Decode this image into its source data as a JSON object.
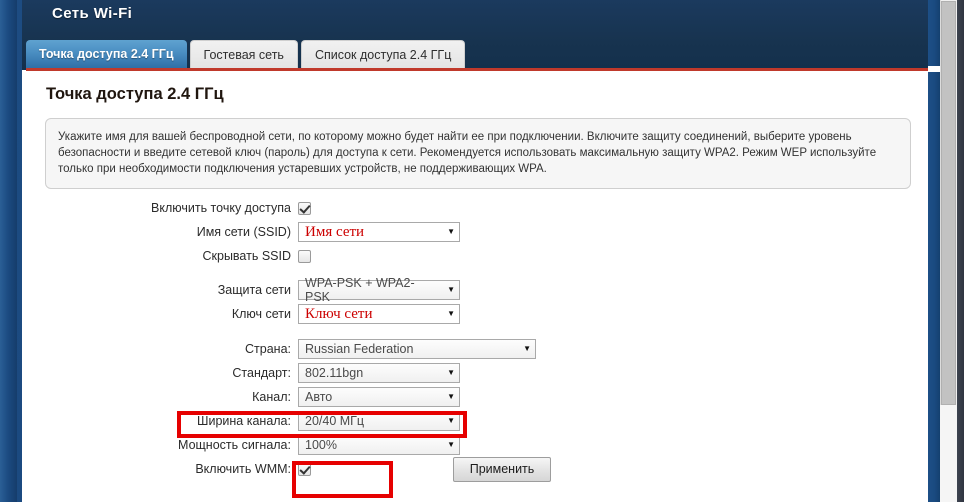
{
  "header": {
    "title": "Сеть Wi-Fi"
  },
  "tabs": [
    {
      "label": "Точка доступа 2.4 ГГц",
      "active": true
    },
    {
      "label": "Гостевая сеть",
      "active": false
    },
    {
      "label": "Список доступа 2.4 ГГц",
      "active": false
    }
  ],
  "page": {
    "title": "Точка доступа 2.4 ГГц",
    "description": "Укажите имя для вашей беспроводной сети, по которому можно будет найти ее при подключении. Включите защиту соединений, выберите уровень безопасности и введите сетевой ключ (пароль) для доступа к сети. Рекомендуется использовать максимальную защиту WPA2. Режим WEP используйте только при необходимости подключения устаревших устройств, не поддерживающих WPA."
  },
  "form": {
    "enable_ap": {
      "label": "Включить точку доступа",
      "checked": true
    },
    "ssid": {
      "label": "Имя сети (SSID)",
      "value": "Имя сети"
    },
    "hide_ssid": {
      "label": "Скрывать SSID",
      "checked": false
    },
    "security": {
      "label": "Защита сети",
      "value": "WPA-PSK + WPA2-PSK"
    },
    "network_key": {
      "label": "Ключ сети",
      "value": "Ключ сети"
    },
    "country": {
      "label": "Страна:",
      "value": "Russian Federation"
    },
    "standard": {
      "label": "Стандарт:",
      "value": "802.11bgn"
    },
    "channel": {
      "label": "Канал:",
      "value": "Авто"
    },
    "channel_width": {
      "label": "Ширина канала:",
      "value": "20/40 МГц"
    },
    "signal_power": {
      "label": "Мощность сигнала:",
      "value": "100%"
    },
    "enable_wmm": {
      "label": "Включить WMM:",
      "checked": true
    }
  },
  "actions": {
    "apply_label": "Применить"
  },
  "colors": {
    "accent_red": "#e60000",
    "tab_active": "#4a8ec2",
    "header_navy": "#17334f",
    "value_red": "#cc0000"
  },
  "icons": {
    "dropdown_arrow": "▼"
  }
}
